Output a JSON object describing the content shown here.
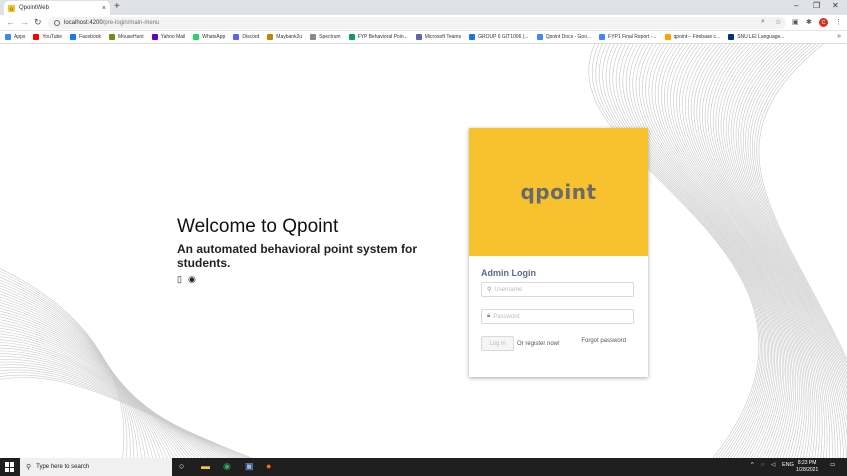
{
  "browser": {
    "tab_title": "QpointWeb",
    "tab_close": "×",
    "new_tab": "+",
    "url_host": "localhost:4200",
    "url_path": "/pre-login/main-menu",
    "profile_initial": "C",
    "bookmarks": [
      {
        "label": "Apps",
        "color": "#4285f4"
      },
      {
        "label": "YouTube",
        "color": "#ff0000"
      },
      {
        "label": "Facebook",
        "color": "#1877f2"
      },
      {
        "label": "MouseHunt",
        "color": "#6b8e23"
      },
      {
        "label": "Yahoo Mail",
        "color": "#6001d2"
      },
      {
        "label": "WhatsApp",
        "color": "#25d366"
      },
      {
        "label": "Discord",
        "color": "#5865f2"
      },
      {
        "label": "Maybank2u",
        "color": "#b8860b"
      },
      {
        "label": "Spectrum",
        "color": "#888888"
      },
      {
        "label": "FYP Behavioral Poin...",
        "color": "#0f9d58"
      },
      {
        "label": "Microsoft Teams",
        "color": "#6264a7"
      },
      {
        "label": "GROUP 6 GIT1006 (...",
        "color": "#1a73e8"
      },
      {
        "label": "Qpoint Docs - Goo...",
        "color": "#4285f4"
      },
      {
        "label": "FYP1 Final Report -...",
        "color": "#4285f4"
      },
      {
        "label": "qpoint – Firebase c...",
        "color": "#ffa000"
      },
      {
        "label": "SNU LEI Language...",
        "color": "#003876"
      }
    ]
  },
  "page": {
    "welcome_title": "Welcome to Qpoint",
    "welcome_subtitle": "An automated behavioral point system for students."
  },
  "login": {
    "logo_text": "qpoint",
    "title": "Admin Login",
    "username_placeholder": "Username",
    "password_placeholder": "Password",
    "login_button": "Log in",
    "register_text": "Or register now!",
    "forgot_text": "Forgot password"
  },
  "taskbar": {
    "search_placeholder": "Type here to search",
    "language": "ENG",
    "time": "8:23 PM",
    "date": "1/28/2021"
  }
}
